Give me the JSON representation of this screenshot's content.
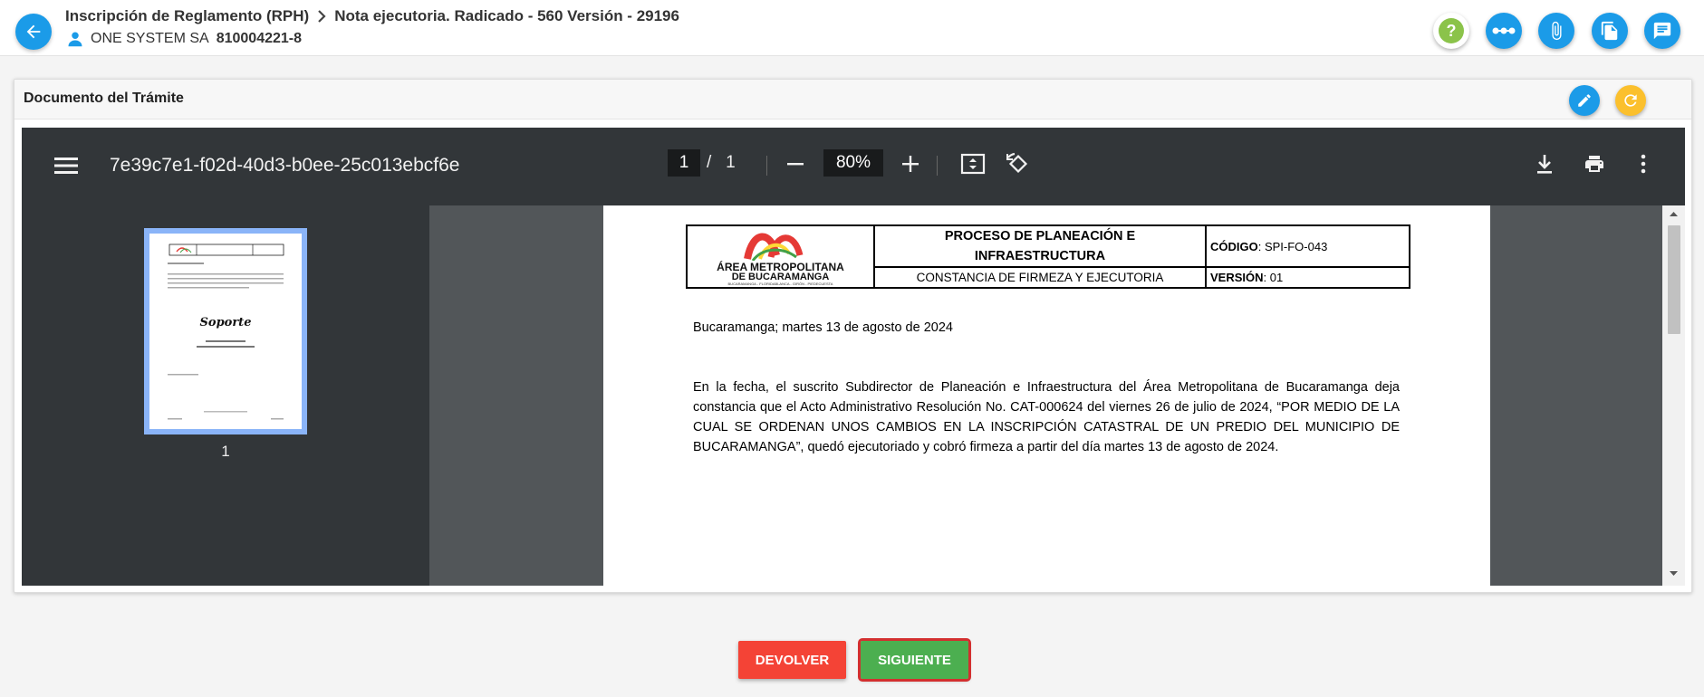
{
  "header": {
    "breadcrumb_1": "Inscripción de Reglamento (RPH)",
    "breadcrumb_2": "Nota ejecutoria. Radicado - 560 Versión - 29196",
    "user_name": "ONE SYSTEM SA",
    "user_id": "810004221-8",
    "accent": "#1b9be8",
    "help_color": "#8bc34a"
  },
  "card": {
    "title": "Documento del Trámite",
    "edit_color": "#1b9be8",
    "refresh_color": "#fbc02d"
  },
  "viewer": {
    "file_title": "7e39c7e1-f02d-40d3-b0ee-25c013ebcf6e",
    "current_page": "1",
    "page_separator": "/",
    "total_pages": "1",
    "zoom": "80%",
    "thumbnail_number": "1"
  },
  "thumbnail": {
    "script_word": "Soporte"
  },
  "document": {
    "logo_line1": "ÁREA METROPOLITANA",
    "logo_line2": "DE BUCARAMANGA",
    "logo_tagline": "BUCARAMANGA - FLORIDABLANCA - GIRÓN - PIEDECUESTA",
    "process_title": "PROCESO DE PLANEACIÓN E INFRAESTRUCTURA",
    "form_title": "CONSTANCIA DE FIRMEZA Y EJECUTORIA",
    "code_label": "CÓDIGO",
    "code_value": ": SPI-FO-043",
    "version_label": "VERSIÓN",
    "version_value": ": 01",
    "date_line": "Bucaramanga; martes 13 de agosto de 2024",
    "body_line1": "En la fecha, el suscrito Subdirector de Planeación e Infraestructura del Área Metropolitana de Bucaramanga deja",
    "body_line2": "constancia que el Acto Administrativo Resolución No. CAT-000624 del viernes 26 de julio de 2024, “POR MEDIO DE LA",
    "body_line3": "CUAL SE ORDENAN UNOS CAMBIOS EN LA INSCRIPCIÓN CATASTRAL DE UN PREDIO DEL MUNICIPIO DE",
    "body_line4": "BUCARAMANGA”, quedó ejecutoriado y cobró firmeza a partir del día martes 13 de agosto de 2024."
  },
  "actions": {
    "return_label": "DEVOLVER",
    "next_label": "SIGUIENTE"
  }
}
